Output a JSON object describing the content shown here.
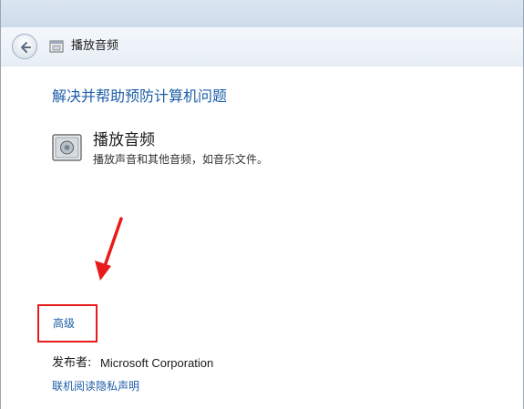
{
  "nav": {
    "title": "播放音频"
  },
  "content": {
    "heading": "解决并帮助预防计算机问题",
    "task_title": "播放音频",
    "task_description": "播放声音和其他音频，如音乐文件。",
    "advanced_link": "高级",
    "publisher_label": "发布者:",
    "publisher_value": "Microsoft Corporation",
    "privacy_link": "联机阅读隐私声明"
  },
  "colors": {
    "link_blue": "#1e5ea8",
    "annotation_red": "#e81b1b"
  },
  "icons": {
    "back": "back-arrow-icon",
    "nav": "troubleshoot-window-icon",
    "task": "speaker-icon",
    "annotation": "red-arrow-icon"
  }
}
